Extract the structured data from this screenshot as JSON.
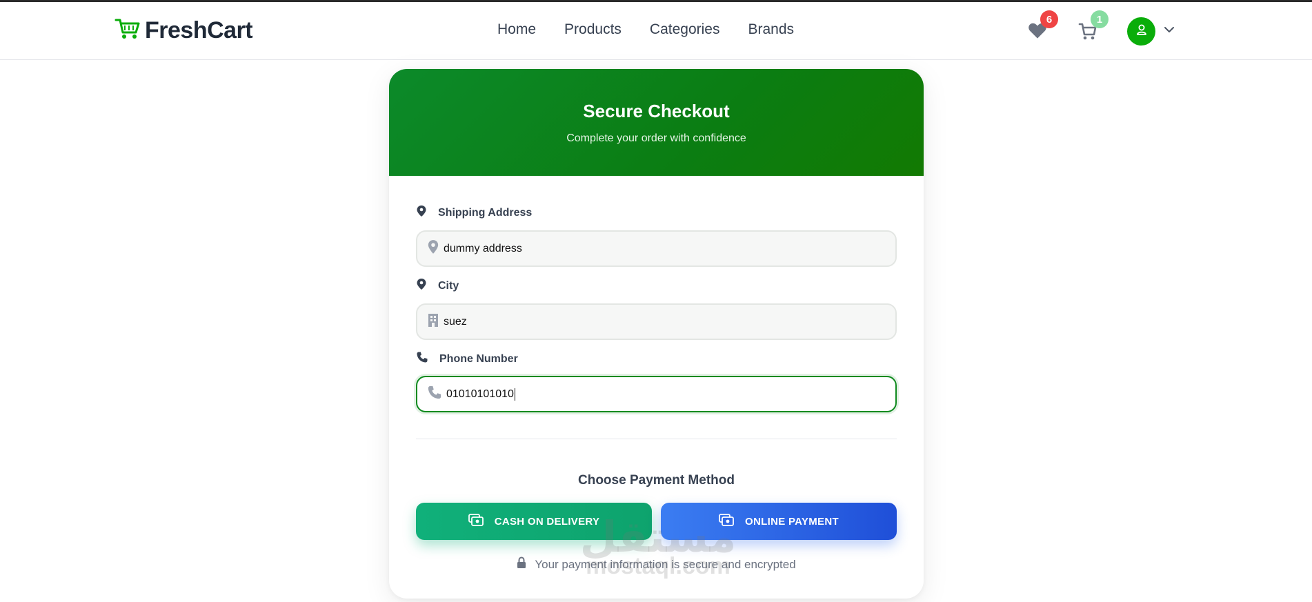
{
  "brand": {
    "name": "FreshCart",
    "accent": "#0aad0a"
  },
  "nav": {
    "links": [
      "Home",
      "Products",
      "Categories",
      "Brands"
    ],
    "wishlist_count": "6",
    "cart_count": "1"
  },
  "checkout": {
    "title": "Secure Checkout",
    "subtitle": "Complete your order with confidence",
    "fields": {
      "address": {
        "label": "Shipping Address",
        "value": "dummy address",
        "icon": "map-pin-icon"
      },
      "city": {
        "label": "City",
        "value": "suez",
        "icon": "city-icon"
      },
      "phone": {
        "label": "Phone Number",
        "value": "01010101010",
        "icon": "phone-icon"
      }
    },
    "payment": {
      "title": "Choose Payment Method",
      "cash_label": "CASH ON DELIVERY",
      "online_label": "ONLINE PAYMENT"
    },
    "secure_note": "Your payment information is secure and encrypted"
  },
  "watermark": {
    "arabic": "مستقل",
    "latin": "mostaql.com"
  },
  "colors": {
    "header_green": "#0b7d12",
    "cash_green": "#10b07a",
    "online_blue": "#2563eb",
    "wishlist_badge": "#ef4444",
    "cart_badge": "#86dca0"
  }
}
